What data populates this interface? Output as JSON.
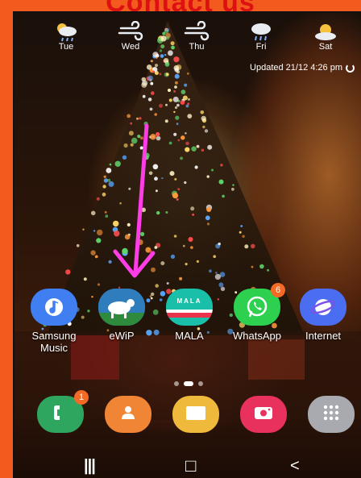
{
  "header": {
    "title": "Contact us"
  },
  "weather": {
    "days": [
      {
        "day": "Tue",
        "icon": "rain-sun-icon"
      },
      {
        "day": "Wed",
        "icon": "wind-icon"
      },
      {
        "day": "Thu",
        "icon": "wind-icon"
      },
      {
        "day": "Fri",
        "icon": "rain-icon"
      },
      {
        "day": "Sat",
        "icon": "partly-sunny-icon"
      }
    ],
    "updated": "Updated 21/12 4:26 pm"
  },
  "apps": [
    {
      "label": "Samsung Music",
      "icon": "music-note-icon",
      "color": "#3f7ff2"
    },
    {
      "label": "eWiP",
      "icon": "ewip-logo-icon",
      "color": "#2f7dbd"
    },
    {
      "label": "MALA",
      "icon": "mala-logo-icon",
      "color": "#19bfa8",
      "text": "MALA"
    },
    {
      "label": "WhatsApp",
      "icon": "whatsapp-icon",
      "color": "#2ed04f",
      "badge": "6"
    },
    {
      "label": "Internet",
      "icon": "globe-icon",
      "color": "#4a6df2"
    }
  ],
  "dock": [
    {
      "name": "phone",
      "icon": "phone-icon",
      "color": "#2fa660",
      "badge": "1"
    },
    {
      "name": "contacts",
      "icon": "contacts-icon",
      "color": "#f08535"
    },
    {
      "name": "files",
      "icon": "folder-icon",
      "color": "#efb93c"
    },
    {
      "name": "screen-recorder",
      "icon": "camera-icon",
      "color": "#e8315d"
    },
    {
      "name": "app-drawer",
      "icon": "grid-icon",
      "color": "#a9aab0"
    }
  ],
  "navbar": {
    "recents": "|||",
    "home": "□",
    "back": "<"
  },
  "annotation": {
    "arrow_color": "#ff3de6",
    "arrow_target": "eWiP"
  }
}
